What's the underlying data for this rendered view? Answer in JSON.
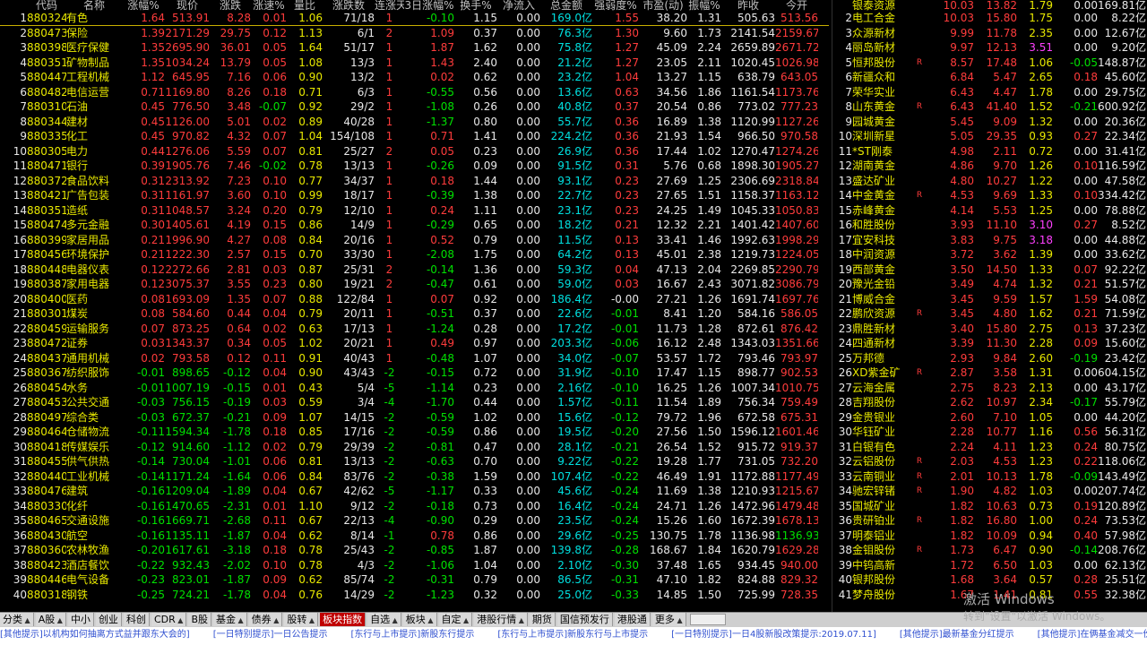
{
  "left_headers": [
    "代码",
    "名称",
    "涨幅%",
    "现价",
    "涨跌",
    "涨速%",
    "量比",
    "涨跌数",
    "连涨天",
    "3日涨幅%",
    "换手%",
    "净流入",
    "总金额",
    "强弱度%",
    "市盈(动)",
    "振幅%",
    "昨收",
    "今开"
  ],
  "sectors": [
    [
      "1",
      "880324",
      "有色",
      "1.64",
      "513.91",
      "8.28",
      "0.01",
      "1.06",
      "71/18",
      "1",
      "-0.10",
      "1.15",
      "0.00",
      "169.0亿",
      "1.55",
      "38.20",
      "1.31",
      "505.63",
      "513.56"
    ],
    [
      "2",
      "880473",
      "保险",
      "1.39",
      "2171.29",
      "29.75",
      "0.12",
      "1.13",
      "6/1",
      "2",
      "1.09",
      "0.37",
      "0.00",
      "76.3亿",
      "1.30",
      "9.60",
      "1.73",
      "2141.54",
      "2159.67"
    ],
    [
      "3",
      "880398",
      "医疗保健",
      "1.35",
      "2695.90",
      "36.01",
      "0.05",
      "1.64",
      "51/17",
      "1",
      "1.87",
      "1.62",
      "0.00",
      "75.8亿",
      "1.27",
      "45.09",
      "2.24",
      "2659.89",
      "2671.72"
    ],
    [
      "4",
      "880351",
      "矿物制品",
      "1.35",
      "1034.24",
      "13.79",
      "0.05",
      "1.08",
      "13/3",
      "1",
      "1.43",
      "2.40",
      "0.00",
      "21.2亿",
      "1.27",
      "23.05",
      "2.11",
      "1020.45",
      "1026.98"
    ],
    [
      "5",
      "880447",
      "工程机械",
      "1.12",
      "645.95",
      "7.16",
      "0.06",
      "0.90",
      "13/2",
      "1",
      "0.02",
      "0.62",
      "0.00",
      "23.2亿",
      "1.04",
      "13.27",
      "1.15",
      "638.79",
      "643.05"
    ],
    [
      "6",
      "880482",
      "电信运营",
      "0.71",
      "1169.80",
      "8.26",
      "0.18",
      "0.71",
      "6/3",
      "1",
      "-0.55",
      "0.56",
      "0.00",
      "13.6亿",
      "0.63",
      "34.56",
      "1.86",
      "1161.54",
      "1173.76"
    ],
    [
      "7",
      "880310",
      "石油",
      "0.45",
      "776.50",
      "3.48",
      "-0.07",
      "0.92",
      "29/2",
      "1",
      "-1.08",
      "0.26",
      "0.00",
      "40.8亿",
      "0.37",
      "20.54",
      "0.86",
      "773.02",
      "777.23"
    ],
    [
      "8",
      "880344",
      "建材",
      "0.45",
      "1126.00",
      "5.01",
      "0.02",
      "0.89",
      "40/28",
      "1",
      "-1.37",
      "0.80",
      "0.00",
      "55.7亿",
      "0.36",
      "16.89",
      "1.38",
      "1120.99",
      "1127.26"
    ],
    [
      "9",
      "880335",
      "化工",
      "0.45",
      "970.82",
      "4.32",
      "0.07",
      "1.04",
      "154/108",
      "1",
      "0.71",
      "1.41",
      "0.00",
      "224.2亿",
      "0.36",
      "21.93",
      "1.54",
      "966.50",
      "970.58"
    ],
    [
      "10",
      "880305",
      "电力",
      "0.44",
      "1276.06",
      "5.59",
      "0.07",
      "0.81",
      "25/27",
      "2",
      "0.05",
      "0.23",
      "0.00",
      "26.9亿",
      "0.36",
      "17.44",
      "1.02",
      "1270.47",
      "1274.26"
    ],
    [
      "11",
      "880471",
      "银行",
      "0.39",
      "1905.76",
      "7.46",
      "-0.02",
      "0.78",
      "13/13",
      "1",
      "-0.26",
      "0.09",
      "0.00",
      "91.5亿",
      "0.31",
      "5.76",
      "0.68",
      "1898.30",
      "1905.27"
    ],
    [
      "12",
      "880372",
      "食品饮料",
      "0.31",
      "2313.92",
      "7.23",
      "0.10",
      "0.77",
      "34/37",
      "1",
      "0.18",
      "1.44",
      "0.00",
      "93.1亿",
      "0.23",
      "27.69",
      "1.25",
      "2306.69",
      "2318.84"
    ],
    [
      "13",
      "880421",
      "广告包装",
      "0.31",
      "1161.97",
      "3.60",
      "0.10",
      "0.99",
      "18/17",
      "1",
      "-0.39",
      "1.38",
      "0.00",
      "22.7亿",
      "0.23",
      "27.65",
      "1.51",
      "1158.37",
      "1163.12"
    ],
    [
      "14",
      "880351",
      "造纸",
      "0.31",
      "1048.57",
      "3.24",
      "0.20",
      "0.79",
      "12/10",
      "1",
      "0.24",
      "1.11",
      "0.00",
      "23.1亿",
      "0.23",
      "24.25",
      "1.49",
      "1045.33",
      "1050.83"
    ],
    [
      "15",
      "880474",
      "多元金融",
      "0.30",
      "1405.61",
      "4.19",
      "0.15",
      "0.86",
      "14/9",
      "1",
      "-0.29",
      "0.65",
      "0.00",
      "18.2亿",
      "0.21",
      "12.32",
      "2.21",
      "1401.42",
      "1407.60"
    ],
    [
      "16",
      "880399",
      "家居用品",
      "0.21",
      "1996.90",
      "4.27",
      "0.08",
      "0.84",
      "20/16",
      "1",
      "0.52",
      "0.79",
      "0.00",
      "11.5亿",
      "0.13",
      "33.41",
      "1.46",
      "1992.63",
      "1998.29"
    ],
    [
      "17",
      "880456",
      "环境保护",
      "0.21",
      "1222.30",
      "2.57",
      "0.15",
      "0.70",
      "33/30",
      "1",
      "-2.08",
      "1.75",
      "0.00",
      "64.2亿",
      "0.13",
      "45.01",
      "2.38",
      "1219.73",
      "1224.05"
    ],
    [
      "18",
      "880448",
      "电器仪表",
      "0.12",
      "2272.66",
      "2.81",
      "0.03",
      "0.87",
      "25/31",
      "2",
      "-0.14",
      "1.36",
      "0.00",
      "59.3亿",
      "0.04",
      "47.13",
      "2.04",
      "2269.85",
      "2290.79"
    ],
    [
      "19",
      "880387",
      "家用电器",
      "0.12",
      "3075.37",
      "3.55",
      "0.23",
      "0.80",
      "19/21",
      "2",
      "-0.47",
      "0.61",
      "0.00",
      "59.0亿",
      "0.03",
      "16.67",
      "2.43",
      "3071.82",
      "3086.79"
    ],
    [
      "20",
      "880400",
      "医药",
      "0.08",
      "1693.09",
      "1.35",
      "0.07",
      "0.88",
      "122/84",
      "1",
      "0.07",
      "0.92",
      "0.00",
      "186.4亿",
      "-0.00",
      "27.21",
      "1.26",
      "1691.74",
      "1697.76"
    ],
    [
      "21",
      "880301",
      "煤炭",
      "0.08",
      "584.60",
      "0.44",
      "0.04",
      "0.79",
      "20/11",
      "1",
      "-0.51",
      "0.37",
      "0.00",
      "22.6亿",
      "-0.01",
      "8.41",
      "1.20",
      "584.16",
      "586.05"
    ],
    [
      "22",
      "880459",
      "运输服务",
      "0.07",
      "873.25",
      "0.64",
      "0.02",
      "0.63",
      "17/13",
      "1",
      "-1.24",
      "0.28",
      "0.00",
      "17.2亿",
      "-0.01",
      "11.73",
      "1.28",
      "872.61",
      "876.42"
    ],
    [
      "23",
      "880472",
      "证券",
      "0.03",
      "1343.37",
      "0.34",
      "0.05",
      "1.02",
      "20/21",
      "1",
      "0.49",
      "0.97",
      "0.00",
      "203.3亿",
      "-0.06",
      "16.12",
      "2.48",
      "1343.03",
      "1351.66"
    ],
    [
      "24",
      "880437",
      "通用机械",
      "0.02",
      "793.58",
      "0.12",
      "0.11",
      "0.91",
      "40/43",
      "1",
      "-0.48",
      "1.07",
      "0.00",
      "34.0亿",
      "-0.07",
      "53.57",
      "1.72",
      "793.46",
      "793.97"
    ],
    [
      "25",
      "880367",
      "纺织服饰",
      "-0.01",
      "898.65",
      "-0.12",
      "0.04",
      "0.90",
      "43/43",
      "-2",
      "-0.15",
      "0.72",
      "0.00",
      "31.9亿",
      "-0.10",
      "17.47",
      "1.15",
      "898.77",
      "902.53"
    ],
    [
      "26",
      "880454",
      "水务",
      "-0.01",
      "1007.19",
      "-0.15",
      "0.01",
      "0.43",
      "5/4",
      "-5",
      "-1.14",
      "0.23",
      "0.00",
      "2.16亿",
      "-0.10",
      "16.25",
      "1.26",
      "1007.34",
      "1010.75"
    ],
    [
      "27",
      "880453",
      "公共交通",
      "-0.03",
      "756.15",
      "-0.19",
      "0.03",
      "0.59",
      "3/4",
      "-4",
      "-1.70",
      "0.44",
      "0.00",
      "1.57亿",
      "-0.11",
      "11.54",
      "1.89",
      "756.34",
      "759.49"
    ],
    [
      "28",
      "880497",
      "综合类",
      "-0.03",
      "672.37",
      "-0.21",
      "0.09",
      "1.07",
      "14/15",
      "-2",
      "-0.59",
      "1.02",
      "0.00",
      "15.6亿",
      "-0.12",
      "79.72",
      "1.96",
      "672.58",
      "675.31"
    ],
    [
      "29",
      "880464",
      "仓储物流",
      "-0.11",
      "1594.34",
      "-1.78",
      "0.18",
      "0.85",
      "17/16",
      "-2",
      "-0.59",
      "0.86",
      "0.00",
      "19.5亿",
      "-0.20",
      "27.56",
      "1.50",
      "1596.12",
      "1601.46"
    ],
    [
      "30",
      "880418",
      "传媒娱乐",
      "-0.12",
      "914.60",
      "-1.12",
      "0.02",
      "0.79",
      "29/39",
      "-2",
      "-0.81",
      "0.47",
      "0.00",
      "28.1亿",
      "-0.21",
      "26.54",
      "1.52",
      "915.72",
      "919.37"
    ],
    [
      "31",
      "880455",
      "供气供热",
      "-0.14",
      "730.04",
      "-1.01",
      "0.06",
      "0.81",
      "13/13",
      "-2",
      "-0.63",
      "0.70",
      "0.00",
      "9.22亿",
      "-0.22",
      "19.28",
      "1.77",
      "731.05",
      "732.20"
    ],
    [
      "32",
      "880440",
      "工业机械",
      "-0.14",
      "1171.24",
      "-1.64",
      "0.06",
      "0.84",
      "83/76",
      "-2",
      "-0.38",
      "1.59",
      "0.00",
      "107.4亿",
      "-0.22",
      "46.49",
      "1.91",
      "1172.88",
      "1177.49"
    ],
    [
      "33",
      "880476",
      "建筑",
      "-0.16",
      "1209.04",
      "-1.89",
      "0.04",
      "0.67",
      "42/62",
      "-5",
      "-1.17",
      "0.33",
      "0.00",
      "45.6亿",
      "-0.24",
      "11.69",
      "1.38",
      "1210.93",
      "1215.67"
    ],
    [
      "34",
      "880330",
      "化纤",
      "-0.16",
      "1470.65",
      "-2.31",
      "0.01",
      "1.10",
      "9/12",
      "-2",
      "-0.18",
      "0.73",
      "0.00",
      "16.4亿",
      "-0.24",
      "24.71",
      "1.26",
      "1472.96",
      "1479.48"
    ],
    [
      "35",
      "880465",
      "交通设施",
      "-0.16",
      "1669.71",
      "-2.68",
      "0.11",
      "0.67",
      "22/13",
      "-4",
      "-0.90",
      "0.29",
      "0.00",
      "23.5亿",
      "-0.24",
      "15.26",
      "1.60",
      "1672.39",
      "1678.13"
    ],
    [
      "36",
      "880430",
      "航空",
      "-0.16",
      "1135.11",
      "-1.87",
      "0.04",
      "0.62",
      "8/14",
      "-1",
      "0.78",
      "0.86",
      "0.00",
      "29.6亿",
      "-0.25",
      "130.75",
      "1.78",
      "1136.98",
      "1136.93"
    ],
    [
      "37",
      "880360",
      "农林牧渔",
      "-0.20",
      "1617.61",
      "-3.18",
      "0.18",
      "0.78",
      "25/43",
      "-2",
      "-0.85",
      "1.87",
      "0.00",
      "139.8亿",
      "-0.28",
      "168.67",
      "1.84",
      "1620.79",
      "1629.28"
    ],
    [
      "38",
      "880423",
      "酒店餐饮",
      "-0.22",
      "932.43",
      "-2.02",
      "0.10",
      "0.78",
      "4/3",
      "-2",
      "-1.06",
      "1.04",
      "0.00",
      "2.10亿",
      "-0.30",
      "37.48",
      "1.65",
      "934.45",
      "940.00"
    ],
    [
      "39",
      "880446",
      "电气设备",
      "-0.23",
      "823.01",
      "-1.87",
      "0.09",
      "0.62",
      "85/74",
      "-2",
      "-0.31",
      "0.79",
      "0.00",
      "86.5亿",
      "-0.31",
      "47.10",
      "1.82",
      "824.88",
      "829.32"
    ],
    [
      "40",
      "880318",
      "钢铁",
      "-0.25",
      "724.21",
      "-1.78",
      "0.04",
      "0.76",
      "14/29",
      "-2",
      "-1.23",
      "0.32",
      "0.00",
      "25.0亿",
      "-0.33",
      "14.85",
      "1.50",
      "725.99",
      "728.35"
    ]
  ],
  "right_headers": [
    "",
    "银泰资源",
    "",
    "10.03",
    "13.82",
    "1.79",
    "0.00",
    "169.81亿"
  ],
  "stocks": [
    [
      "2",
      "电工合金",
      "",
      "10.03",
      "15.80",
      "1.75",
      "0.00",
      "8.22亿"
    ],
    [
      "3",
      "众源新材",
      "",
      "9.99",
      "11.78",
      "2.35",
      "0.00",
      "12.67亿"
    ],
    [
      "4",
      "丽岛新材",
      "",
      "9.97",
      "12.13",
      "3.51",
      "0.00",
      "9.20亿"
    ],
    [
      "5",
      "恒邦股份",
      "R",
      "8.57",
      "17.48",
      "1.06",
      "-0.05",
      "148.87亿"
    ],
    [
      "6",
      "新疆众和",
      "",
      "6.84",
      "5.47",
      "2.65",
      "0.18",
      "45.60亿"
    ],
    [
      "7",
      "荣华实业",
      "",
      "6.43",
      "4.47",
      "1.78",
      "0.00",
      "29.75亿"
    ],
    [
      "8",
      "山东黄金",
      "R",
      "6.43",
      "41.40",
      "1.52",
      "-0.21",
      "600.92亿"
    ],
    [
      "9",
      "园城黄金",
      "",
      "5.45",
      "9.09",
      "1.32",
      "0.00",
      "20.36亿"
    ],
    [
      "10",
      "深圳新星",
      "",
      "5.05",
      "29.35",
      "0.93",
      "0.27",
      "22.34亿"
    ],
    [
      "11",
      "*ST刚泰",
      "",
      "4.98",
      "2.11",
      "0.72",
      "0.00",
      "31.41亿"
    ],
    [
      "12",
      "湖南黄金",
      "",
      "4.86",
      "9.70",
      "1.26",
      "0.10",
      "116.59亿"
    ],
    [
      "13",
      "盛达矿业",
      "",
      "4.80",
      "10.27",
      "1.22",
      "0.00",
      "47.58亿"
    ],
    [
      "14",
      "中金黄金",
      "R",
      "4.53",
      "9.69",
      "1.33",
      "0.10",
      "334.42亿"
    ],
    [
      "15",
      "赤峰黄金",
      "",
      "4.14",
      "5.53",
      "1.25",
      "0.00",
      "78.88亿"
    ],
    [
      "16",
      "和胜股份",
      "",
      "3.93",
      "11.10",
      "3.10",
      "0.27",
      "8.52亿"
    ],
    [
      "17",
      "宜安科技",
      "",
      "3.83",
      "9.75",
      "3.18",
      "0.00",
      "44.88亿"
    ],
    [
      "18",
      "中润资源",
      "",
      "3.72",
      "3.62",
      "1.39",
      "0.00",
      "33.62亿"
    ],
    [
      "19",
      "西部黄金",
      "",
      "3.50",
      "14.50",
      "1.33",
      "0.07",
      "92.22亿"
    ],
    [
      "20",
      "豫光金铅",
      "",
      "3.49",
      "4.74",
      "1.32",
      "0.21",
      "51.57亿"
    ],
    [
      "21",
      "博威合金",
      "",
      "3.45",
      "9.59",
      "1.57",
      "1.59",
      "54.08亿"
    ],
    [
      "22",
      "鹏欣资源",
      "R",
      "3.45",
      "4.80",
      "1.62",
      "0.21",
      "71.59亿"
    ],
    [
      "23",
      "鼎胜新材",
      "",
      "3.40",
      "15.80",
      "2.75",
      "0.13",
      "37.23亿"
    ],
    [
      "24",
      "四通新材",
      "",
      "3.39",
      "11.30",
      "2.28",
      "0.09",
      "15.60亿"
    ],
    [
      "25",
      "万邦德",
      "",
      "2.93",
      "9.84",
      "2.60",
      "-0.19",
      "23.42亿"
    ],
    [
      "26",
      "XD紫金矿",
      "R",
      "2.87",
      "3.58",
      "1.31",
      "0.00",
      "604.15亿"
    ],
    [
      "27",
      "云海金属",
      "",
      "2.75",
      "8.23",
      "2.13",
      "0.00",
      "43.17亿"
    ],
    [
      "28",
      "吉翔股份",
      "",
      "2.62",
      "10.97",
      "2.34",
      "-0.17",
      "55.79亿"
    ],
    [
      "29",
      "金贵银业",
      "",
      "2.60",
      "7.10",
      "1.05",
      "0.00",
      "44.20亿"
    ],
    [
      "30",
      "华钰矿业",
      "",
      "2.28",
      "10.77",
      "1.16",
      "0.56",
      "56.31亿"
    ],
    [
      "31",
      "白银有色",
      "",
      "2.24",
      "4.11",
      "1.23",
      "0.24",
      "80.75亿"
    ],
    [
      "32",
      "云铝股份",
      "R",
      "2.03",
      "4.53",
      "1.23",
      "0.22",
      "118.06亿"
    ],
    [
      "33",
      "云南铜业",
      "R",
      "2.01",
      "10.13",
      "1.78",
      "-0.09",
      "143.49亿"
    ],
    [
      "34",
      "驰宏锌锗",
      "R",
      "1.90",
      "4.82",
      "1.03",
      "0.00",
      "207.74亿"
    ],
    [
      "35",
      "国城矿业",
      "",
      "1.82",
      "10.63",
      "0.73",
      "0.19",
      "120.89亿"
    ],
    [
      "36",
      "贵研铂业",
      "R",
      "1.82",
      "16.80",
      "1.00",
      "0.24",
      "73.53亿"
    ],
    [
      "37",
      "明泰铝业",
      "",
      "1.82",
      "10.09",
      "0.94",
      "0.40",
      "57.98亿"
    ],
    [
      "38",
      "金钼股份",
      "R",
      "1.73",
      "6.47",
      "0.90",
      "-0.14",
      "208.76亿"
    ],
    [
      "39",
      "中钨高新",
      "",
      "1.72",
      "6.50",
      "1.03",
      "0.00",
      "62.13亿"
    ],
    [
      "40",
      "银邦股份",
      "",
      "1.68",
      "3.64",
      "0.57",
      "0.28",
      "25.51亿"
    ],
    [
      "41",
      "梦舟股份",
      "",
      "1.67",
      "1.41",
      "0.81",
      "0.55",
      "32.38亿"
    ]
  ],
  "tabs": [
    {
      "label": "分类",
      "arrow": true
    },
    {
      "label": "A股",
      "arrow": true
    },
    {
      "label": "中小",
      "arrow": false
    },
    {
      "label": "创业",
      "arrow": false
    },
    {
      "label": "科创",
      "arrow": false
    },
    {
      "label": "CDR",
      "arrow": true
    },
    {
      "label": "B股",
      "arrow": false
    },
    {
      "label": "基金",
      "arrow": true
    },
    {
      "label": "债券",
      "arrow": true
    },
    {
      "label": "股转",
      "arrow": true
    },
    {
      "label": "板块指数",
      "arrow": false,
      "active": true
    },
    {
      "label": "自选",
      "arrow": true
    },
    {
      "label": "板块",
      "arrow": true
    },
    {
      "label": "自定",
      "arrow": true
    },
    {
      "label": "港股行情",
      "arrow": true
    },
    {
      "label": "期货",
      "arrow": false
    },
    {
      "label": "国信预发行",
      "arrow": false
    },
    {
      "label": "港股通",
      "arrow": false
    },
    {
      "label": "更多",
      "arrow": true
    }
  ],
  "news": [
    "[其他提示]以机构如何抽离方式益并跟东大会的]",
    "[一日特别提示]一日公告提示",
    "[东行与上市提示]新股东行提示",
    "[东行与上市提示]新股东行与上市提示",
    "[一日特别提示]一日4股新股改策提示:2019.07.11]",
    "[其他提示]最新基金分红提示",
    "[其他提示]在俩基金减交一份表"
  ],
  "watermark": {
    "line1": "激活 Windows",
    "line2": "转到\"设置\"以激活 Windows。"
  }
}
